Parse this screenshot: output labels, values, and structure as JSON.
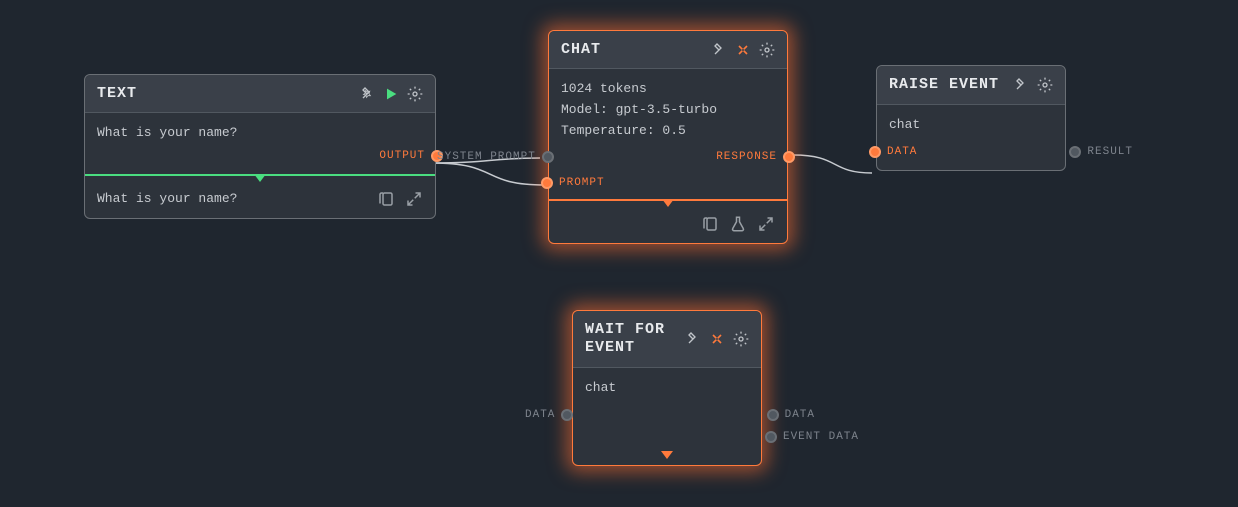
{
  "nodes": {
    "text": {
      "title": "TEXT",
      "body": "What is your name?",
      "output_label": "OUTPUT",
      "result_text": "What is your name?"
    },
    "chat": {
      "title": "CHAT",
      "lines": {
        "tokens": "1024 tokens",
        "model": "Model: gpt-3.5-turbo",
        "temperature": "Temperature: 0.5"
      },
      "ports": {
        "system_prompt": "SYSTEM PROMPT",
        "prompt": "PROMPT",
        "response": "RESPONSE"
      }
    },
    "raise": {
      "title": "RAISE EVENT",
      "body": "chat",
      "ports": {
        "data": "DATA",
        "result": "RESULT"
      }
    },
    "wait": {
      "title": "WAIT FOR EVENT",
      "body": "chat",
      "ports": {
        "data_in": "DATA",
        "data_out": "DATA",
        "event_data": "EVENT DATA"
      }
    }
  }
}
